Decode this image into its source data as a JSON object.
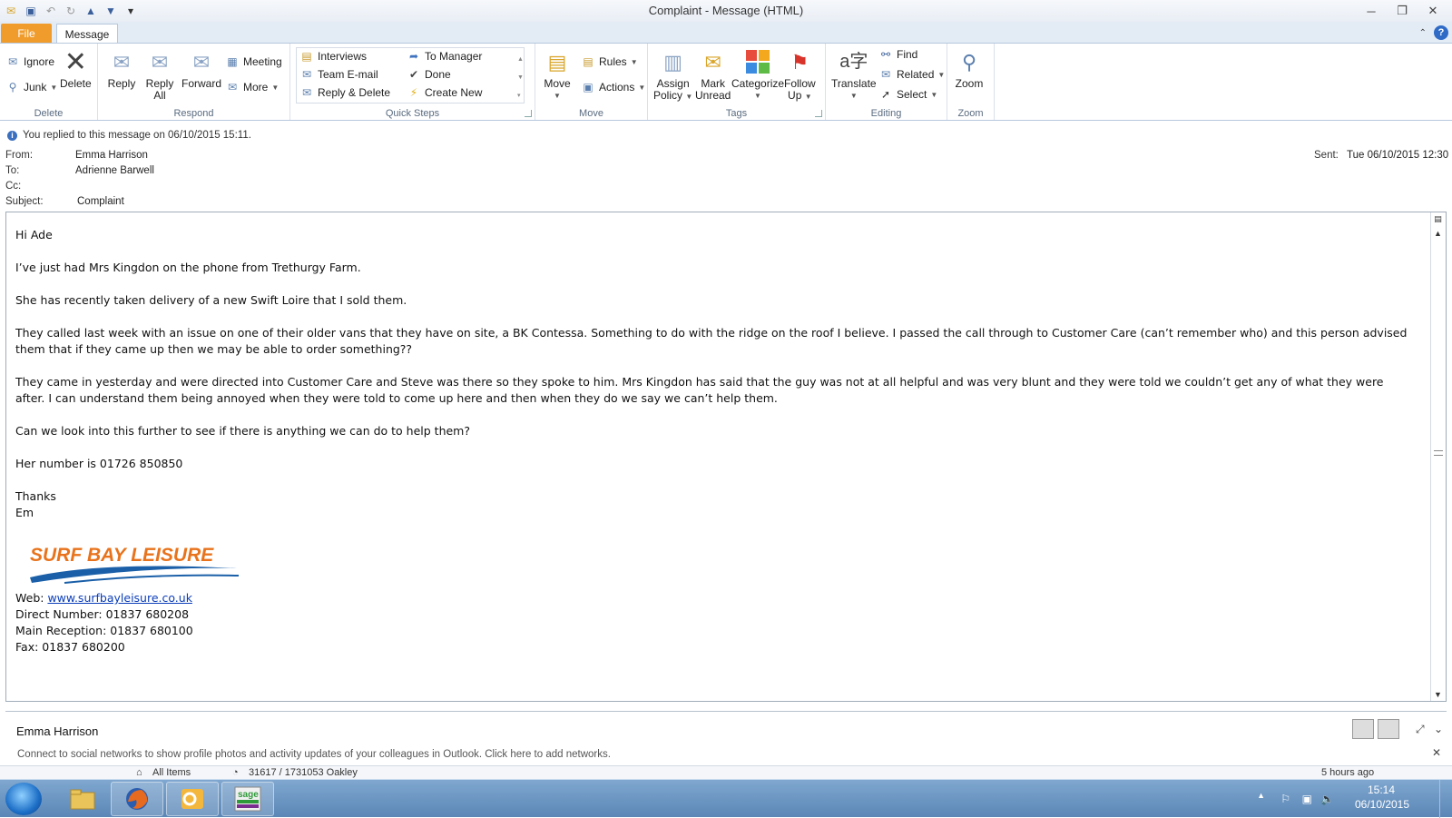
{
  "window": {
    "title": "Complaint  -  Message (HTML)"
  },
  "tabs": {
    "file": "File",
    "message": "Message"
  },
  "ribbon": {
    "delete_group": {
      "label": "Delete",
      "ignore": "Ignore",
      "junk": "Junk",
      "delete": "Delete"
    },
    "respond_group": {
      "label": "Respond",
      "reply": "Reply",
      "reply_all_1": "Reply",
      "reply_all_2": "All",
      "forward": "Forward",
      "meeting": "Meeting",
      "more": "More"
    },
    "quicksteps_group": {
      "label": "Quick Steps",
      "items": [
        "Interviews",
        "Team E-mail",
        "Reply & Delete",
        "To Manager",
        "Done",
        "Create New"
      ]
    },
    "move_group": {
      "label": "Move",
      "move": "Move",
      "rules": "Rules",
      "actions": "Actions"
    },
    "tags_group": {
      "label": "Tags",
      "assign_1": "Assign",
      "assign_2": "Policy",
      "mark_1": "Mark",
      "mark_2": "Unread",
      "categorize": "Categorize",
      "follow_1": "Follow",
      "follow_2": "Up"
    },
    "editing_group": {
      "label": "Editing",
      "translate": "Translate",
      "find": "Find",
      "related": "Related",
      "select": "Select"
    },
    "zoom_group": {
      "label": "Zoom",
      "zoom": "Zoom"
    }
  },
  "message": {
    "info_bar": "You replied to this message on 06/10/2015 15:11.",
    "from_label": "From:",
    "from": "Emma Harrison",
    "to_label": "To:",
    "to": "Adrienne Barwell",
    "cc_label": "Cc:",
    "subject_label": "Subject:",
    "subject": "Complaint",
    "sent_label": "Sent:",
    "sent": "Tue 06/10/2015 12:30",
    "body": {
      "greeting": "Hi Ade",
      "p1": "I’ve just had Mrs Kingdon on the phone from Trethurgy Farm.",
      "p2": "She has recently taken delivery of a new Swift Loire that I sold them.",
      "p3": "They called last week with an issue on one of their older vans that they have on site, a BK Contessa.  Something to do with the ridge on the roof I believe.  I passed the call through to Customer Care (can’t remember who) and this person advised them that if they came up then we may be able to order something??",
      "p4": "They came in yesterday and were directed into Customer Care and Steve was there so they spoke to him.  Mrs Kingdon has said that the guy was not at all helpful and was very blunt and they were told we couldn’t get any of what they were after.  I can understand them being annoyed when they were told to come up here and then when they do we say we can’t help them.",
      "p5": "Can we look into this further to see if there is anything we can do to help them?",
      "p6": "Her number is 01726 850850",
      "thanks": "Thanks",
      "sign": "Em"
    },
    "signature": {
      "logo_text": "SURF BAY LEISURE",
      "web_label": "Web: ",
      "web": "www.surfbayleisure.co.uk",
      "direct": "Direct Number:  01837 680208",
      "reception": "Main Reception:  01837 680100",
      "fax": "Fax:  01837 680200"
    }
  },
  "people_pane": {
    "name": "Emma Harrison",
    "message": "Connect to social networks to show profile photos and activity updates of your colleagues in Outlook. Click here to add networks."
  },
  "status_strip": {
    "all_items": "All Items",
    "item": "31617 / 1731053 Oakley",
    "time": "5 hours ago"
  },
  "taskbar": {
    "time": "15:14",
    "date": "06/10/2015"
  },
  "colors": {
    "file_tab": "#f09c2c",
    "accent": "#2f6bc6",
    "logo_orange": "#e8731c",
    "logo_blue": "#1a5fa8"
  }
}
